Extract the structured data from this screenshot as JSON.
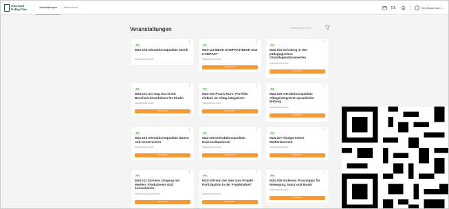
{
  "header": {
    "logo_line1": "Oberland",
    "logo_line2": "Kolleg Plan",
    "nav": [
      {
        "label": "Veranstaltungen",
        "active": true
      },
      {
        "label": "Meine Kurse",
        "active": false
      }
    ],
    "language": "DE",
    "user_name": "Max Mustermann"
  },
  "main": {
    "title": "Veranstaltungen",
    "search_placeholder": "Veranstaltung suchen"
  },
  "badge_label": "Frei",
  "cards": [
    {
      "title": "M24-104 Interaktionsqualität: Musik",
      "subtitle": "PQB-MODULE KURS",
      "button": "Registrieren"
    },
    {
      "title": "M24-115 BESK KOMPAKT/BESK-DaZ KOMPAKT",
      "subtitle": "PQB-MODULE KURS",
      "button": "Registrieren"
    },
    {
      "title": "M24-100 Schulung in den pädagogischen Grundlagendokumenten",
      "subtitle": "PQB-MODULE KURS",
      "button": "Registrieren"
    },
    {
      "title": "M24-101 Ich mag das nicht! Beschwerdeverfahren für Kinder",
      "subtitle": "PQB-MODULE KURS",
      "button": "Registrieren"
    },
    {
      "title": "M24-102 Praxis-Kurs: Portfolio einfach im Alltag integrieren",
      "subtitle": "PQB-MODULE KURS",
      "button": "Registrieren"
    },
    {
      "title": "M24-106 Interaktionsqualität: Alltagsintegrierte sprachliche Bildung",
      "subtitle": "PQB-MODULE KURS",
      "button": "Registrieren"
    },
    {
      "title": "M24-103 Interaktionsqualität: Bauen und Konstruieren",
      "subtitle": "PQB-MODULE KURS",
      "button": "Registrieren"
    },
    {
      "title": "M24-105 Interaktionsqualität: Essenssituationen",
      "subtitle": "PQB-MODULE KURS",
      "button": "Registrieren"
    },
    {
      "title": "M24-107 Kindgerechter Medienkonsum",
      "subtitle": "PQB-MODULE KURS",
      "button": "Registrieren"
    },
    {
      "title": "M24-111 Sicherer Umgang mit Medien: Produzieren statt konsumieren",
      "subtitle": "PQB-MODULE PLATTFORM",
      "button": "Registrieren"
    },
    {
      "title": "M24-109 Von der Idee zum Projekt - Partizipation in der Projektarbeit",
      "subtitle": "PQB-MODULE KURS",
      "button": "Registrieren"
    },
    {
      "title": "M24-108 Vorlesen: Praxistipps für Bewegung, Natur und Musik",
      "subtitle": "PQB-MODULE KURS",
      "button": "Registrieren"
    }
  ]
}
